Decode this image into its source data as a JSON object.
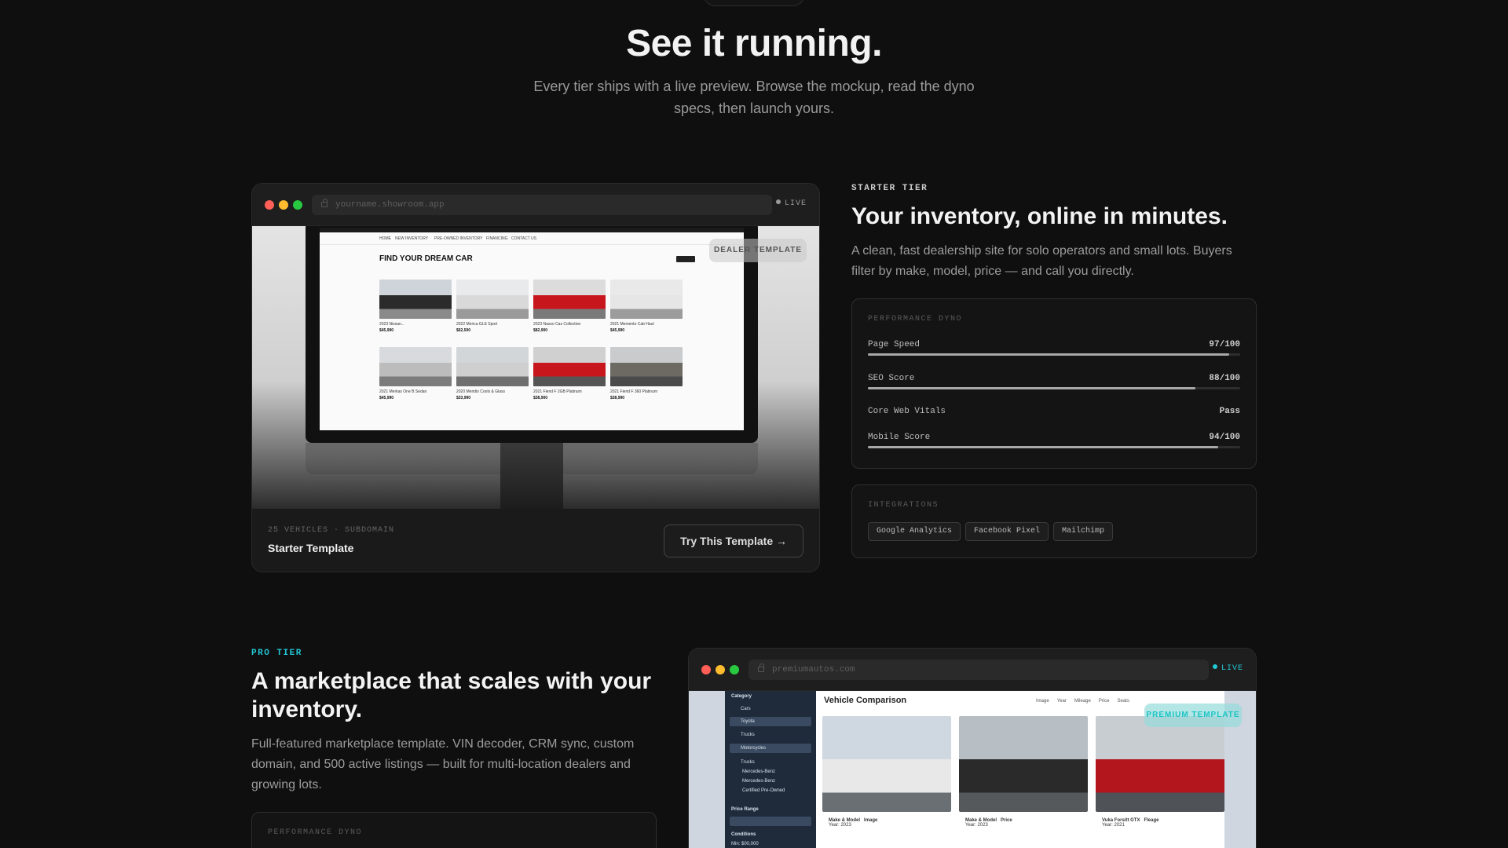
{
  "hero": {
    "title": "See it running.",
    "subtitle": "Every tier ships with a live preview. Browse the mockup, read the dyno specs, then launch yours."
  },
  "colors": {
    "accent_pro": "#22c8d6",
    "live_dot_starter": "#9a9a9a",
    "bg": "#0f0f0f"
  },
  "starter": {
    "tier_label": "STARTER TIER",
    "title": "Your inventory, online in minutes.",
    "description": "A clean, fast dealership site for solo operators and small lots. Buyers filter by make, model, price — and call you directly.",
    "url": "yourname.showroom.app",
    "live_label": "LIVE",
    "badge": "DEALER TEMPLATE",
    "preview": {
      "heading": "FIND YOUR DREAM CAR",
      "nav": [
        "HOME",
        "NEW INVENTORY",
        "PRE-OWNED INVENTORY",
        "FINANCING",
        "CONTACT US"
      ],
      "cars": [
        {
          "name": "2023 Nissan...",
          "price": "$45,990",
          "color": "#2b2b2b"
        },
        {
          "name": "2022 Merica GLE Sport",
          "price": "$62,500",
          "color": "#d9d9d9"
        },
        {
          "name": "2023 Nasso Cas Collection",
          "price": "$82,900",
          "color": "#c8161d"
        },
        {
          "name": "2021 Memento Cab Haul",
          "price": "$45,990",
          "color": "#e6e6e6"
        },
        {
          "name": "2021 Merkas One B Sedan",
          "price": "$45,990",
          "color": "#bcbcbc"
        },
        {
          "name": "2020 Meridio Cools & Glass",
          "price": "$33,990",
          "color": "#cfcfcf"
        },
        {
          "name": "2021 Fiend F 2GB Platinum",
          "price": "$38,900",
          "color": "#c8161d"
        },
        {
          "name": "2021 Fiend F 360 Platinum",
          "price": "$38,990",
          "color": "#6c6a62"
        }
      ]
    },
    "footer": {
      "meta": "25 VEHICLES · SUBDOMAIN",
      "name": "Starter Template",
      "button": "Try This Template →"
    },
    "dyno": {
      "label": "PERFORMANCE DYNO",
      "metrics": [
        {
          "name": "Page Speed",
          "value": "97/100",
          "fill": 0.97
        },
        {
          "name": "SEO Score",
          "value": "88/100",
          "fill": 0.88
        },
        {
          "name": "Core Web Vitals",
          "value": "Pass",
          "fill": null
        },
        {
          "name": "Mobile Score",
          "value": "94/100",
          "fill": 0.94
        }
      ]
    },
    "integrations": {
      "label": "INTEGRATIONS",
      "items": [
        "Google Analytics",
        "Facebook Pixel",
        "Mailchimp"
      ]
    }
  },
  "pro": {
    "tier_label": "PRO TIER",
    "title": "A marketplace that scales with your inventory.",
    "description": "Full-featured marketplace template. VIN decoder, CRM sync, custom domain, and 500 active listings — built for multi-location dealers and growing lots.",
    "dyno_label": "PERFORMANCE DYNO",
    "url": "premiumautos.com",
    "live_label": "LIVE",
    "badge": "PREMIUM TEMPLATE",
    "preview": {
      "heading": "Vehicle Comparison",
      "tabs": [
        "Image",
        "Year",
        "Mileage",
        "Price",
        "Seats"
      ],
      "sidebar": [
        "Category",
        "Cars",
        "Toyota",
        "Trucks",
        "Motorcycles",
        "Trucks",
        "Mercedes-Benz",
        "Mercedes-Benz",
        "Certified Pre-Owned",
        "Price Range",
        "Conditions",
        "Min: $00,000"
      ],
      "cars": [
        {
          "model": "Make & Model",
          "spec": "Image",
          "year": "Year: 2023",
          "color": "#e8e8e8"
        },
        {
          "model": "Make & Model",
          "spec": "Price",
          "year": "Year: 2023",
          "color": "#2a2a2a"
        },
        {
          "model": "Vuka Forsitt GTX",
          "spec": "Fleage",
          "year": "Year: 2021",
          "color": "#b3161d"
        }
      ]
    }
  }
}
